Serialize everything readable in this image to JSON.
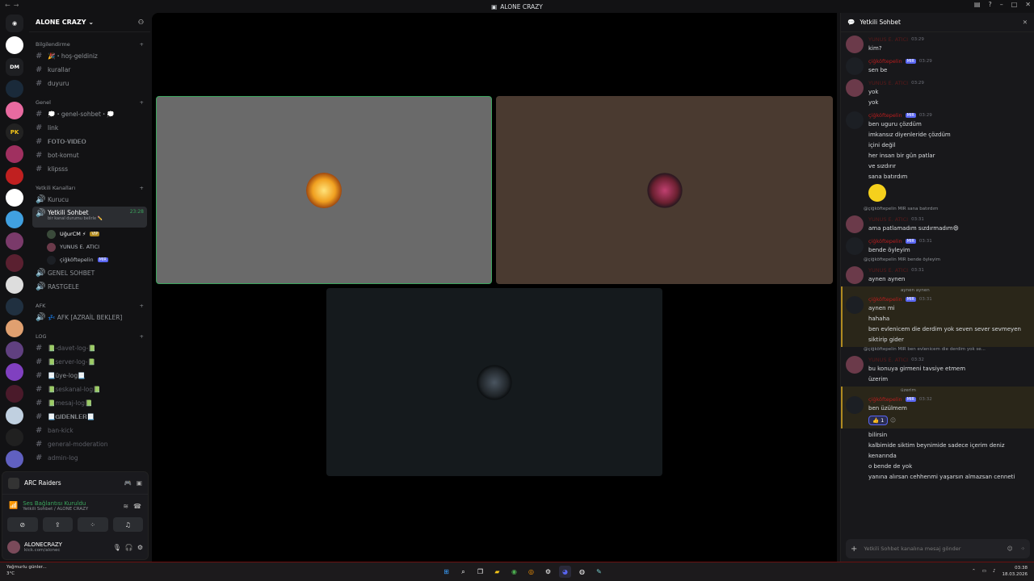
{
  "window": {
    "title": "ALONE CRAZY"
  },
  "server": {
    "name": "ALONE CRAZY"
  },
  "sidebar": {
    "categories": [
      {
        "name": "Bilgilendirme",
        "channels": [
          "🎉・hoş-geldiniz",
          "kurallar",
          "duyuru"
        ]
      },
      {
        "name": "Genel",
        "channels": [
          "💭・genel-sohbet・💭",
          "link",
          "𝐅𝐎𝐓𝐎-𝐕𝐈𝐃𝐄𝐎",
          "bot-komut",
          "klipsss"
        ]
      },
      {
        "name": "Yetkili Kanalları",
        "voice": [
          "Kurucu"
        ]
      },
      {
        "name": "AFK",
        "voice": [
          "💤 AFK [AZRAİL BEKLER]"
        ]
      },
      {
        "name": "LOG",
        "channels": [
          "📗-davet-log-📗",
          "📗server-log-📗",
          "📃üye-log📃",
          "📗seskanal-log📗",
          "📗mesaj-log📗",
          "📃𝐆𝐈𝐃𝐄𝐍𝐋𝐄𝐑📃",
          "ban-kick",
          "general-moderation",
          "admin-log"
        ]
      }
    ],
    "active_voice": {
      "name": "Yetkili Sohbet",
      "time": "23:28",
      "status": "bir kanal durumu belirle ✏️"
    },
    "voice_users": [
      {
        "name": "UğurCM ⚡",
        "badge": "VIP"
      },
      {
        "name": "YUNUS E. ATICI",
        "badge": ""
      },
      {
        "name": "çiğköftepelin",
        "badge": "MIR"
      }
    ],
    "other_voice": [
      "GENEL SOHBET",
      "RASTGELE"
    ]
  },
  "activity": {
    "name": "ARC Raiders"
  },
  "voice_connection": {
    "status": "Ses Bağlantısı Kuruldu",
    "channel": "Yetkili Sohbet / ALONE CRAZY"
  },
  "user": {
    "name": "ALONECRAZY",
    "status": "kick.com/alonec"
  },
  "chat": {
    "title": "Yetkili Sohbet",
    "input_placeholder": "Yetkili Sohbet kanalına mesaj gönder",
    "messages": [
      {
        "author": "YUNUS E. ATICI",
        "time": "03:29",
        "lines": [
          "kim?"
        ]
      },
      {
        "author": "çiğköftepelin",
        "time": "03:29",
        "badge": "MIR",
        "lines": [
          "sen be"
        ]
      },
      {
        "author": "YUNUS E. ATICI",
        "time": "03:29",
        "lines": [
          "yok",
          "yok"
        ]
      },
      {
        "author": "çiğköftepelin",
        "time": "03:29",
        "badge": "MIR",
        "lines": [
          "ben uguru çözdüm",
          "imkansız diyenleride çözdüm",
          "içini değil",
          "her insan bir gün patlar",
          "ve sızdırır",
          "sana batırdım"
        ]
      },
      {
        "author": "YUNUS E. ATICI",
        "time": "03:31",
        "reply": "@çiğköftepelin MIR sana batırdım",
        "lines": [
          "ama patlamadım sızdırmadım😄"
        ]
      },
      {
        "author": "çiğköftepelin",
        "time": "03:31",
        "badge": "MIR",
        "lines": [
          "bende öyleyim"
        ]
      },
      {
        "author": "YUNUS E. ATICI",
        "time": "03:31",
        "reply": "@çiğköftepelin MIR bende öyleyim",
        "lines": [
          "aynen  aynen"
        ]
      },
      {
        "author": "çiğköftepelin",
        "time": "03:31",
        "badge": "MIR",
        "reply": "aynen  aynen",
        "highlight": true,
        "lines": [
          "aynen mi",
          "hahaha",
          "ben evlenicem die derdim yok seven sever sevmeyen",
          "siktirip gider"
        ]
      },
      {
        "author": "YUNUS E. ATICI",
        "time": "03:32",
        "reply": "@çiğköftepelin MIR ben evlenicem die derdim yok se...",
        "lines": [
          "bu konuya girmeni tavsiye etmem",
          "üzerim"
        ]
      },
      {
        "author": "çiğköftepelin",
        "time": "03:32",
        "badge": "MIR",
        "reply": "üzerim",
        "highlight": true,
        "lines": [
          "ben üzülmem"
        ],
        "reaction": "👍 1"
      },
      {
        "continuation": true,
        "lines": [
          "bilirsin",
          "kalbimide siktim beynimide sadece içerim deniz",
          "kenarında",
          "o bende de yok",
          "yanına alırsan cehhenmi yaşarsın almazsan cenneti"
        ]
      }
    ]
  },
  "taskbar": {
    "weather_title": "Yağmurlu günler...",
    "weather_temp": "3°C",
    "time": "03:38",
    "date": "18.03.2026"
  }
}
